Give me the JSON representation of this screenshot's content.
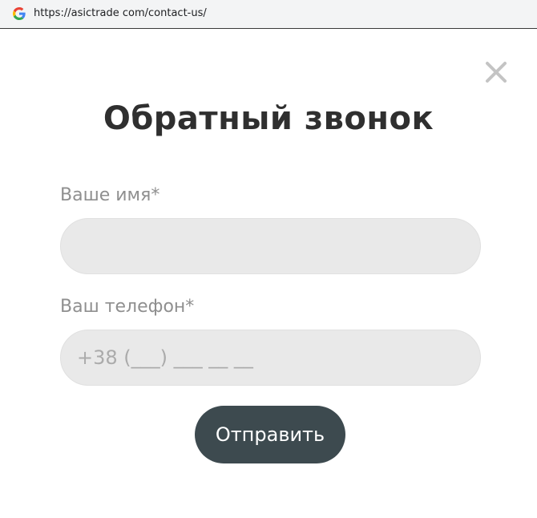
{
  "browser": {
    "url": "https://asictrade com/contact-us/",
    "favicon": "google-g-icon"
  },
  "modal": {
    "title": "Обратный звонок",
    "close_icon": "close-icon",
    "name_label": "Ваше имя*",
    "name_value": "",
    "phone_label": "Ваш телефон*",
    "phone_placeholder": "+38 (___) ___ __ __",
    "submit_label": "Отправить"
  },
  "colors": {
    "title": "#2f2f2f",
    "label": "#8f8f8f",
    "field_bg": "#e9e9e9",
    "button_bg": "#3d4a4f",
    "button_text": "#ffffff"
  }
}
